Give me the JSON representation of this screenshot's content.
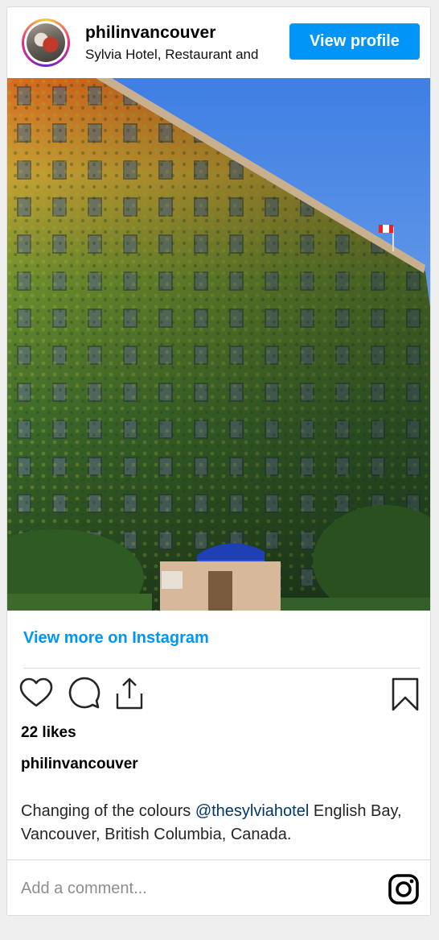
{
  "header": {
    "username": "philinvancouver",
    "location": "Sylvia Hotel, Restaurant and",
    "view_profile_label": "View profile"
  },
  "photo": {
    "subject": "ivy-covered hotel facade"
  },
  "view_more_label": "View more on Instagram",
  "actions": {
    "icons": [
      "heart-icon",
      "comment-icon",
      "share-icon",
      "bookmark-icon"
    ]
  },
  "likes": "22 likes",
  "caption": {
    "username": "philinvancouver",
    "text_before": "Changing of the colours ",
    "mention": "@thesylviahotel",
    "text_after": " English Bay, Vancouver, British Columbia, Canada."
  },
  "comment": {
    "placeholder": "Add a comment..."
  },
  "colors": {
    "accent": "#0095f6",
    "mention": "#00376b",
    "border": "#dbdbdb",
    "placeholder": "#8e8e8e"
  }
}
